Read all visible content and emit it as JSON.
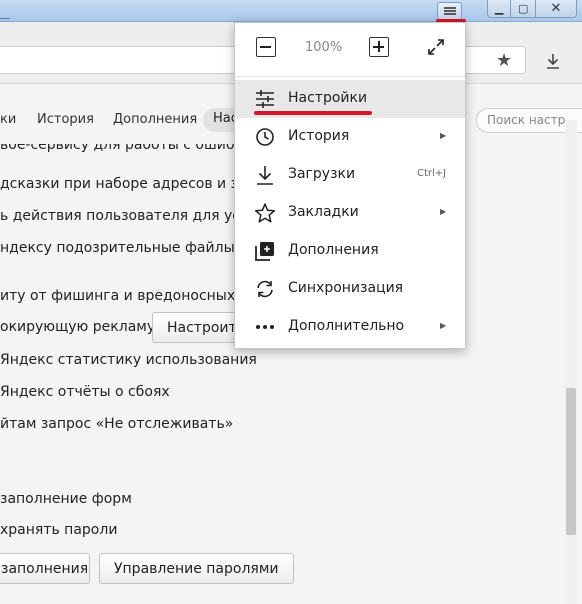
{
  "window": {
    "controls": {
      "minimize": "▁",
      "maximize": "▢",
      "close": "✕"
    }
  },
  "toolbar": {
    "bookmark_icon": "star-icon",
    "download_icon": "download-icon"
  },
  "tabs": {
    "items": [
      "ки",
      "История",
      "Дополнения"
    ],
    "active": "Нас",
    "search_placeholder": "Поиск настр"
  },
  "settings": {
    "lines": [
      "вое-сервису для работы с ошибка",
      "дсказки при наборе адресов и зап",
      "ь действия пользователя для уско",
      "ндексу подозрительные файлы и и",
      "иту от фишинга и вредоносных про",
      "окирующую рекламу",
      "Яндекс статистику использования",
      "Яндекс отчёты о сбоях",
      "йтам запрос «Не отслеживать»",
      "заполнение форм",
      "хранять пароли"
    ],
    "buttons": {
      "configure": "Настроит",
      "autofill": "заполнения",
      "manage_passwords": "Управление паролями"
    }
  },
  "menu": {
    "zoom": "100%",
    "items": [
      {
        "label": "Настройки",
        "icon": "sliders-icon",
        "highlighted": true
      },
      {
        "label": "История",
        "icon": "clock-icon",
        "submenu": true
      },
      {
        "label": "Загрузки",
        "icon": "download-icon",
        "shortcut": "Ctrl+J"
      },
      {
        "label": "Закладки",
        "icon": "star-icon",
        "submenu": true
      },
      {
        "label": "Дополнения",
        "icon": "extensions-icon"
      },
      {
        "label": "Синхронизация",
        "icon": "sync-icon"
      },
      {
        "label": "Дополнительно",
        "icon": "more-dots-icon",
        "submenu": true
      }
    ]
  },
  "colors": {
    "annotation_red": "#d7152b",
    "titlebar_blue": "#b5cfee"
  }
}
